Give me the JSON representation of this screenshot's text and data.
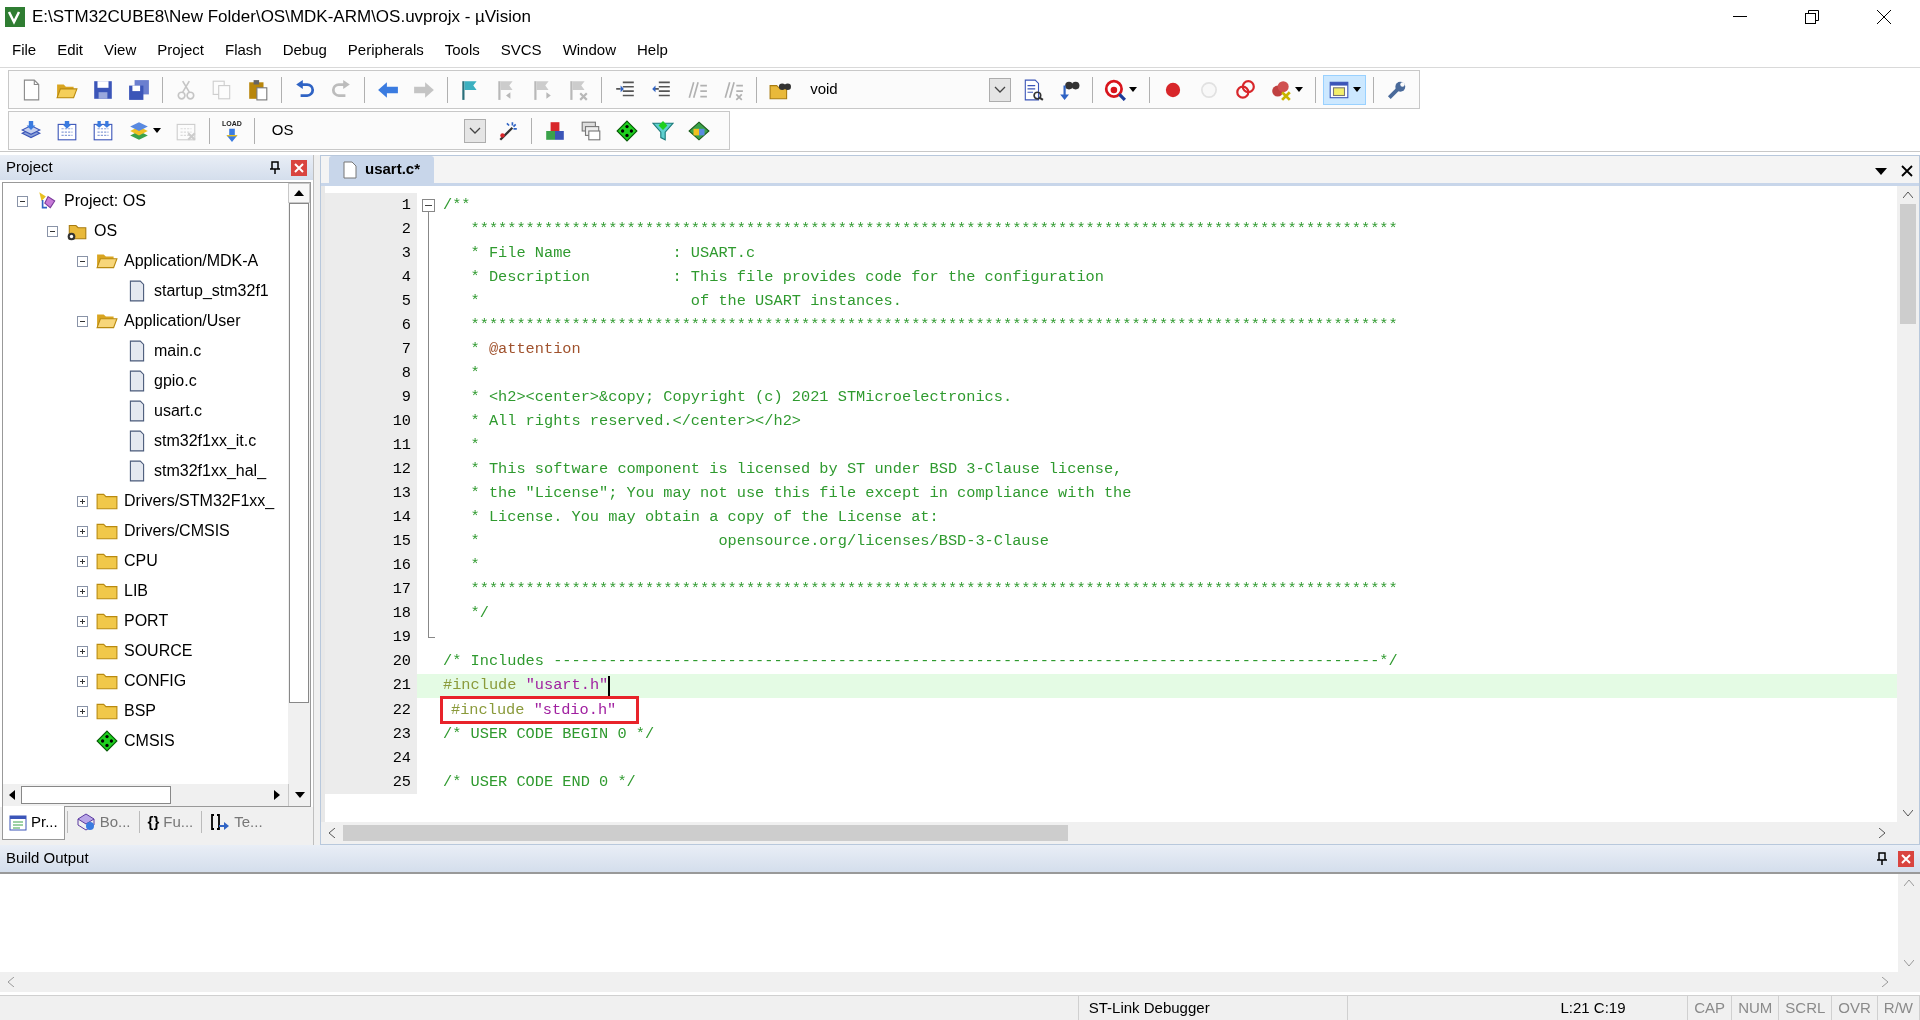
{
  "window": {
    "title": "E:\\STM32CUBE8\\New Folder\\OS\\MDK-ARM\\OS.uvprojx - µVision"
  },
  "menu": [
    "File",
    "Edit",
    "View",
    "Project",
    "Flash",
    "Debug",
    "Peripherals",
    "Tools",
    "SVCS",
    "Window",
    "Help"
  ],
  "toolbars": [
    {
      "items": [
        {
          "kind": "new",
          "disabled": false,
          "pressed": false
        },
        {
          "kind": "open",
          "disabled": false,
          "pressed": false
        },
        {
          "kind": "save",
          "disabled": false,
          "pressed": false
        },
        {
          "kind": "save-all",
          "disabled": false,
          "pressed": false
        },
        {
          "kind": "separator"
        },
        {
          "kind": "cut",
          "disabled": true,
          "pressed": false
        },
        {
          "kind": "copy",
          "disabled": true,
          "pressed": false
        },
        {
          "kind": "paste",
          "disabled": false,
          "pressed": false
        },
        {
          "kind": "separator"
        },
        {
          "kind": "undo",
          "disabled": false,
          "pressed": false
        },
        {
          "kind": "redo",
          "disabled": true,
          "pressed": false
        },
        {
          "kind": "separator"
        },
        {
          "kind": "back",
          "disabled": false,
          "pressed": false
        },
        {
          "kind": "forward",
          "disabled": true,
          "pressed": false
        },
        {
          "kind": "separator"
        },
        {
          "kind": "bookmark",
          "disabled": false,
          "pressed": false
        },
        {
          "kind": "bookmark-prev",
          "disabled": true,
          "pressed": false
        },
        {
          "kind": "bookmark-next",
          "disabled": true,
          "pressed": false
        },
        {
          "kind": "bookmark-clear",
          "disabled": true,
          "pressed": false
        },
        {
          "kind": "separator"
        },
        {
          "kind": "indent",
          "disabled": false,
          "pressed": false
        },
        {
          "kind": "unindent",
          "disabled": false,
          "pressed": false
        },
        {
          "kind": "comment",
          "disabled": true,
          "pressed": false
        },
        {
          "kind": "uncomment",
          "disabled": true,
          "pressed": false
        },
        {
          "kind": "separator"
        },
        {
          "kind": "find-in-files",
          "disabled": false,
          "pressed": false
        },
        {
          "kind": "combo",
          "value": "void"
        },
        {
          "kind": "find",
          "disabled": false,
          "pressed": false
        },
        {
          "kind": "incremental-find",
          "disabled": false,
          "pressed": false
        },
        {
          "kind": "separator"
        },
        {
          "kind": "debug",
          "disabled": false,
          "pressed": false,
          "dropdown": true
        },
        {
          "kind": "separator"
        },
        {
          "kind": "breakpoint",
          "disabled": false,
          "pressed": false
        },
        {
          "kind": "breakpoint-disable",
          "disabled": true,
          "pressed": false
        },
        {
          "kind": "breakpoint-toggle",
          "disabled": false,
          "pressed": false
        },
        {
          "kind": "breakpoint-kill",
          "disabled": false,
          "pressed": false,
          "dropdown": true
        },
        {
          "kind": "separator"
        },
        {
          "kind": "window",
          "disabled": false,
          "pressed": true,
          "dropdown": true
        },
        {
          "kind": "separator"
        },
        {
          "kind": "wrench",
          "disabled": false,
          "pressed": false
        }
      ]
    },
    {
      "items": [
        {
          "kind": "translate",
          "disabled": false,
          "pressed": false
        },
        {
          "kind": "build",
          "disabled": false,
          "pressed": false
        },
        {
          "kind": "rebuild",
          "disabled": false,
          "pressed": false
        },
        {
          "kind": "batch",
          "disabled": false,
          "pressed": false,
          "dropdown": true
        },
        {
          "kind": "stop",
          "disabled": true,
          "pressed": false
        },
        {
          "kind": "separator"
        },
        {
          "kind": "load",
          "label": "LOAD",
          "disabled": false,
          "pressed": false
        },
        {
          "kind": "separator"
        },
        {
          "kind": "combo",
          "value": "OS"
        },
        {
          "kind": "wand",
          "disabled": false,
          "pressed": false
        },
        {
          "kind": "separator"
        },
        {
          "kind": "manage",
          "disabled": false,
          "pressed": false
        },
        {
          "kind": "books",
          "disabled": false,
          "pressed": false
        },
        {
          "kind": "rte",
          "disabled": false,
          "pressed": false
        },
        {
          "kind": "funnel",
          "disabled": false,
          "pressed": false
        },
        {
          "kind": "packs",
          "disabled": false,
          "pressed": false
        }
      ]
    }
  ],
  "project_panel": {
    "title": "Project",
    "tree": [
      {
        "kind": "project",
        "label": "Project: OS",
        "expanded": true,
        "children": [
          {
            "kind": "target",
            "label": "OS",
            "expanded": true,
            "children": [
              {
                "kind": "group",
                "label": "Application/MDK-A",
                "expanded": true,
                "children": [
                  {
                    "kind": "file",
                    "label": "startup_stm32f1"
                  }
                ]
              },
              {
                "kind": "group",
                "label": "Application/User",
                "expanded": true,
                "children": [
                  {
                    "kind": "file",
                    "label": "main.c"
                  },
                  {
                    "kind": "file",
                    "label": "gpio.c"
                  },
                  {
                    "kind": "file",
                    "label": "usart.c"
                  },
                  {
                    "kind": "file",
                    "label": "stm32f1xx_it.c"
                  },
                  {
                    "kind": "file",
                    "label": "stm32f1xx_hal_"
                  }
                ]
              },
              {
                "kind": "group",
                "label": "Drivers/STM32F1xx_",
                "expanded": false
              },
              {
                "kind": "group",
                "label": "Drivers/CMSIS",
                "expanded": false
              },
              {
                "kind": "group",
                "label": "CPU",
                "expanded": false
              },
              {
                "kind": "group",
                "label": "LIB",
                "expanded": false
              },
              {
                "kind": "group",
                "label": "PORT",
                "expanded": false
              },
              {
                "kind": "group",
                "label": "SOURCE",
                "expanded": false
              },
              {
                "kind": "group",
                "label": "CONFIG",
                "expanded": false
              },
              {
                "kind": "group",
                "label": "BSP",
                "expanded": false
              },
              {
                "kind": "component",
                "label": "CMSIS"
              }
            ]
          }
        ]
      }
    ],
    "tabs": [
      {
        "kind": "project",
        "label": "Pr...",
        "selected": true
      },
      {
        "kind": "books",
        "label": "Bo...",
        "selected": false
      },
      {
        "kind": "functions",
        "glyph": "{}",
        "label": "Fu...",
        "selected": false
      },
      {
        "kind": "templates",
        "label": "Te...",
        "selected": false
      }
    ]
  },
  "editor": {
    "tabs": [
      {
        "label": "usart.c*",
        "selected": true
      }
    ],
    "lines": [
      {
        "number": "1",
        "collapsible": true,
        "expanded": true,
        "tokens": [
          {
            "kind": "comment",
            "text": "/**"
          }
        ]
      },
      {
        "number": "2",
        "tokens": [
          {
            "kind": "comment",
            "text": "   *****************************************************************************************************"
          }
        ]
      },
      {
        "number": "3",
        "tokens": [
          {
            "kind": "comment",
            "text": "   * File Name           : USART.c"
          }
        ]
      },
      {
        "number": "4",
        "tokens": [
          {
            "kind": "comment",
            "text": "   * Description         : This file provides code for the configuration"
          }
        ]
      },
      {
        "number": "5",
        "tokens": [
          {
            "kind": "comment",
            "text": "   *                       of the USART instances."
          }
        ]
      },
      {
        "number": "6",
        "tokens": [
          {
            "kind": "comment",
            "text": "   *****************************************************************************************************"
          }
        ]
      },
      {
        "number": "7",
        "tokens": [
          {
            "kind": "comment",
            "text": "   * "
          },
          {
            "kind": "doc-tag",
            "text": "@attention"
          }
        ]
      },
      {
        "number": "8",
        "tokens": [
          {
            "kind": "comment",
            "text": "   *"
          }
        ]
      },
      {
        "number": "9",
        "tokens": [
          {
            "kind": "comment",
            "text": "   * <h2><center>&copy; Copyright (c) 2021 STMicroelectronics."
          }
        ]
      },
      {
        "number": "10",
        "tokens": [
          {
            "kind": "comment",
            "text": "   * All rights reserved.</center></h2>"
          }
        ]
      },
      {
        "number": "11",
        "tokens": [
          {
            "kind": "comment",
            "text": "   *"
          }
        ]
      },
      {
        "number": "12",
        "tokens": [
          {
            "kind": "comment",
            "text": "   * This software component is licensed by ST under BSD 3-Clause license,"
          }
        ]
      },
      {
        "number": "13",
        "tokens": [
          {
            "kind": "comment",
            "text": "   * the \"License\"; You may not use this file except in compliance with the"
          }
        ]
      },
      {
        "number": "14",
        "tokens": [
          {
            "kind": "comment",
            "text": "   * License. You may obtain a copy of the License at:"
          }
        ]
      },
      {
        "number": "15",
        "tokens": [
          {
            "kind": "comment",
            "text": "   *                          opensource.org/licenses/BSD-3-Clause"
          }
        ]
      },
      {
        "number": "16",
        "tokens": [
          {
            "kind": "comment",
            "text": "   *"
          }
        ]
      },
      {
        "number": "17",
        "tokens": [
          {
            "kind": "comment",
            "text": "   *****************************************************************************************************"
          }
        ]
      },
      {
        "number": "18",
        "tokens": [
          {
            "kind": "comment",
            "text": "   */"
          }
        ]
      },
      {
        "number": "19",
        "fold_end": true
      },
      {
        "number": "20",
        "tokens": [
          {
            "kind": "comment",
            "text": "/* Includes ------------------------------------------------------------------------------------------*/"
          }
        ]
      },
      {
        "number": "21",
        "current": true,
        "caret": true,
        "tokens": [
          {
            "kind": "preprocessor",
            "text": "#include "
          },
          {
            "kind": "string",
            "text": "\"usart.h\""
          }
        ]
      },
      {
        "number": "22",
        "marked": true,
        "tokens": [
          {
            "kind": "preprocessor",
            "text": "#include "
          },
          {
            "kind": "string",
            "text": "\"stdio.h\""
          }
        ]
      },
      {
        "number": "23",
        "tokens": [
          {
            "kind": "comment",
            "text": "/* USER CODE BEGIN 0 */"
          }
        ]
      },
      {
        "number": "24"
      },
      {
        "number": "25",
        "tokens": [
          {
            "kind": "comment",
            "text": "/* USER CODE END 0 */"
          }
        ]
      }
    ]
  },
  "build_output": {
    "title": "Build Output"
  },
  "status_bar": {
    "debugger": "ST-Link Debugger",
    "position": "L:21 C:19",
    "indicators": [
      {
        "label": "CAP",
        "on": false
      },
      {
        "label": "NUM",
        "on": false
      },
      {
        "label": "SCRL",
        "on": false
      },
      {
        "label": "OVR",
        "on": false
      },
      {
        "label": "R/W",
        "on": false
      }
    ]
  }
}
